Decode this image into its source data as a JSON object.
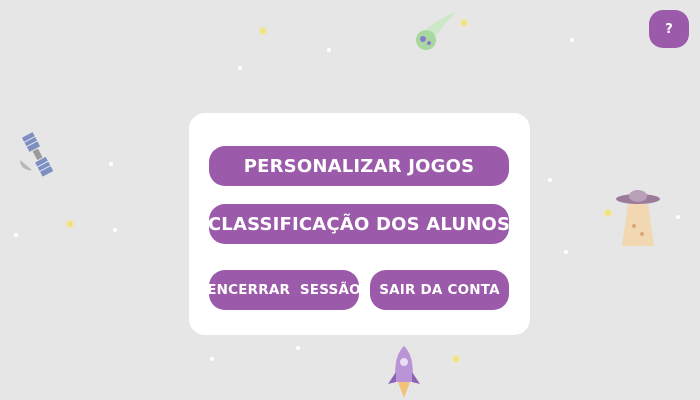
{
  "help": {
    "label": "?"
  },
  "menu": {
    "personalize_label": "PERSONALIZAR JOGOS",
    "ranking_label": "CLASSIFICAÇÃO DOS ALUNOS",
    "end_session_label": "ENCERRAR  SESSÃO",
    "logout_label": "SAIR DA CONTA"
  },
  "colors": {
    "background": "#e6e6e6",
    "button": "#9b5aaa",
    "card": "#ffffff",
    "button_text": "#ffffff"
  },
  "decorations": [
    "comet-icon",
    "satellite-icon",
    "ufo-icon",
    "rocket-icon",
    "star-icon"
  ]
}
